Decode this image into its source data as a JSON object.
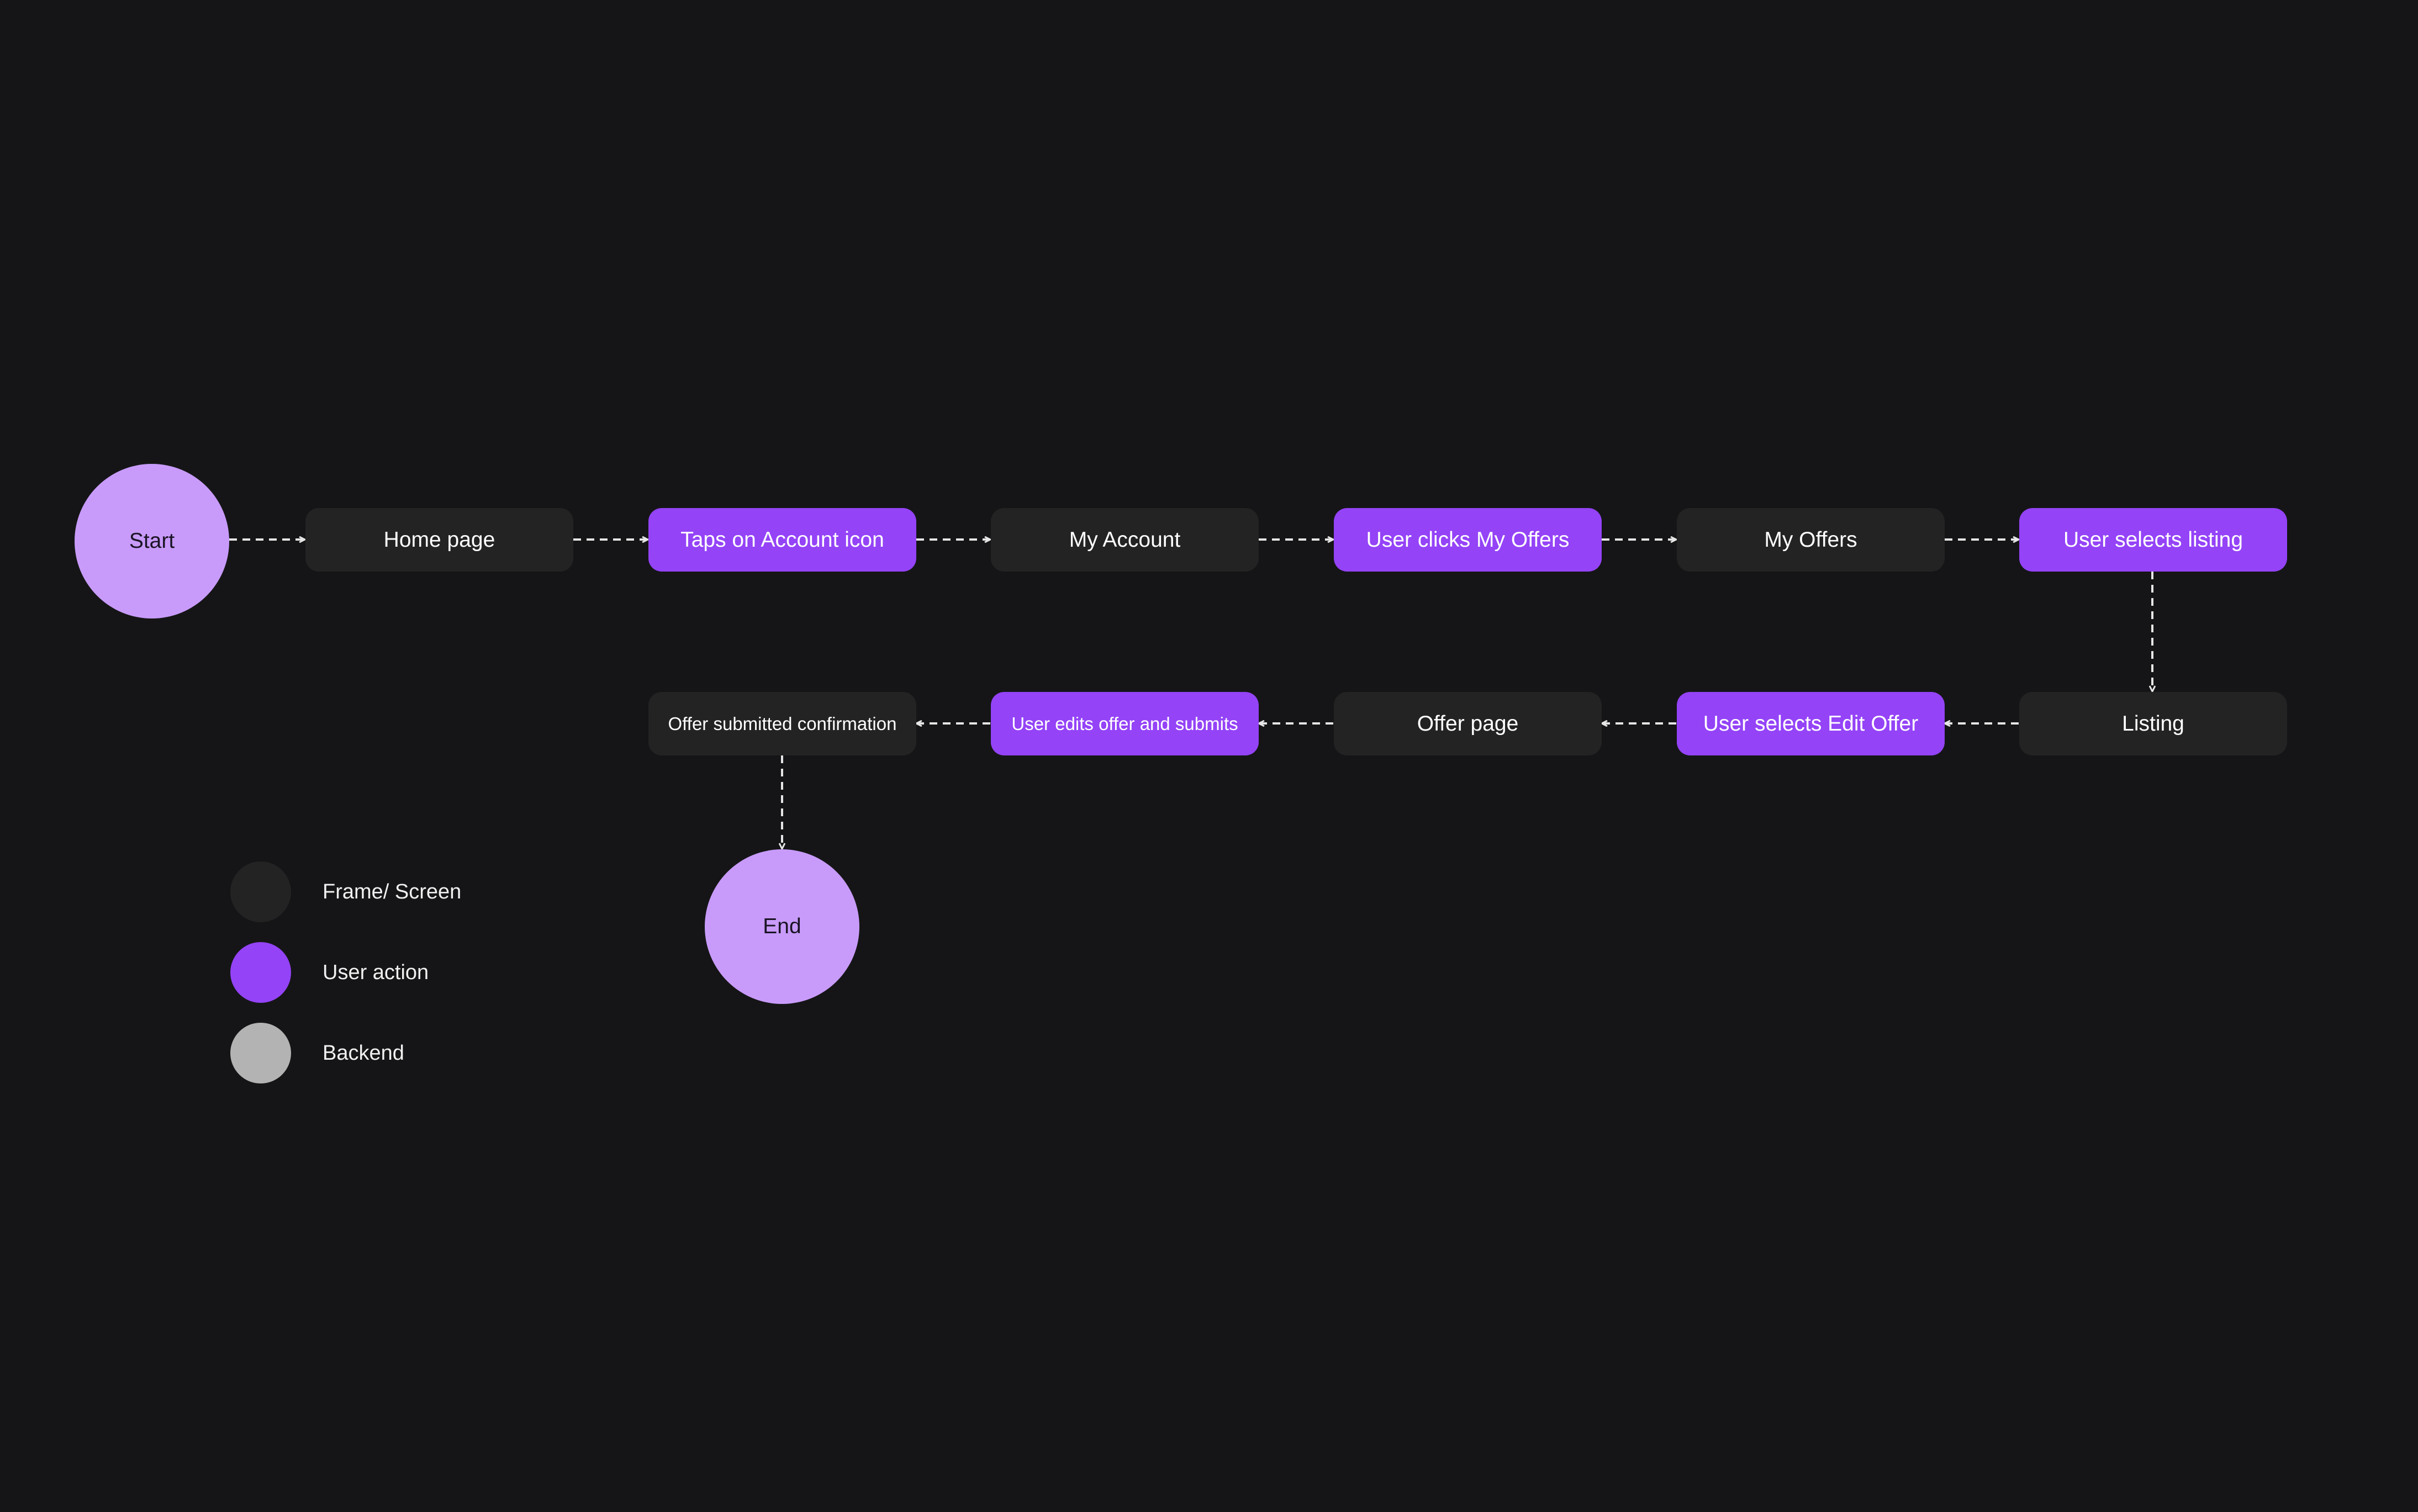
{
  "colors": {
    "background": "#151517",
    "screen": "#232324",
    "action": "#9443f7",
    "terminal": "#c89bfb",
    "backend": "#b3b3b3",
    "connector": "#e6e6e6"
  },
  "terminals": {
    "start": "Start",
    "end": "End"
  },
  "steps": [
    {
      "label": "Home page",
      "kind": "screen"
    },
    {
      "label": "Taps on Account icon",
      "kind": "action"
    },
    {
      "label": "My Account",
      "kind": "screen"
    },
    {
      "label": "User clicks My Offers",
      "kind": "action"
    },
    {
      "label": "My Offers",
      "kind": "screen"
    },
    {
      "label": "User selects listing",
      "kind": "action"
    },
    {
      "label": "Listing",
      "kind": "screen"
    },
    {
      "label": "User selects Edit Offer",
      "kind": "action"
    },
    {
      "label": "Offer page",
      "kind": "screen"
    },
    {
      "label": "User edits offer and submits",
      "kind": "action"
    },
    {
      "label": "Offer submitted confirmation",
      "kind": "screen"
    }
  ],
  "legend": [
    {
      "label": "Frame/ Screen",
      "color": "#232324"
    },
    {
      "label": "User action",
      "color": "#9443f7"
    },
    {
      "label": "Backend",
      "color": "#b3b3b3"
    }
  ]
}
